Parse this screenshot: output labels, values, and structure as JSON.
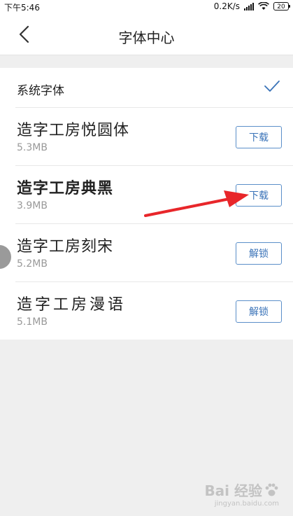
{
  "status": {
    "time": "下午5:46",
    "network_speed": "0.2K/s",
    "battery": "20"
  },
  "header": {
    "title": "字体中心"
  },
  "system_font": {
    "label": "系统字体"
  },
  "fonts": [
    {
      "name": "造字工房悦圆体",
      "size": "5.3MB",
      "action": "下载"
    },
    {
      "name": "造字工房典黑",
      "size": "3.9MB",
      "action": "下载"
    },
    {
      "name": "造字工房刻宋",
      "size": "5.2MB",
      "action": "解锁"
    },
    {
      "name": "造字工房漫语",
      "size": "5.1MB",
      "action": "解锁"
    }
  ],
  "watermark": {
    "main": "Bai 经验",
    "sub": "jingyan.baidu.com"
  },
  "colors": {
    "accent": "#3a73b8",
    "arrow": "#e8262a"
  }
}
